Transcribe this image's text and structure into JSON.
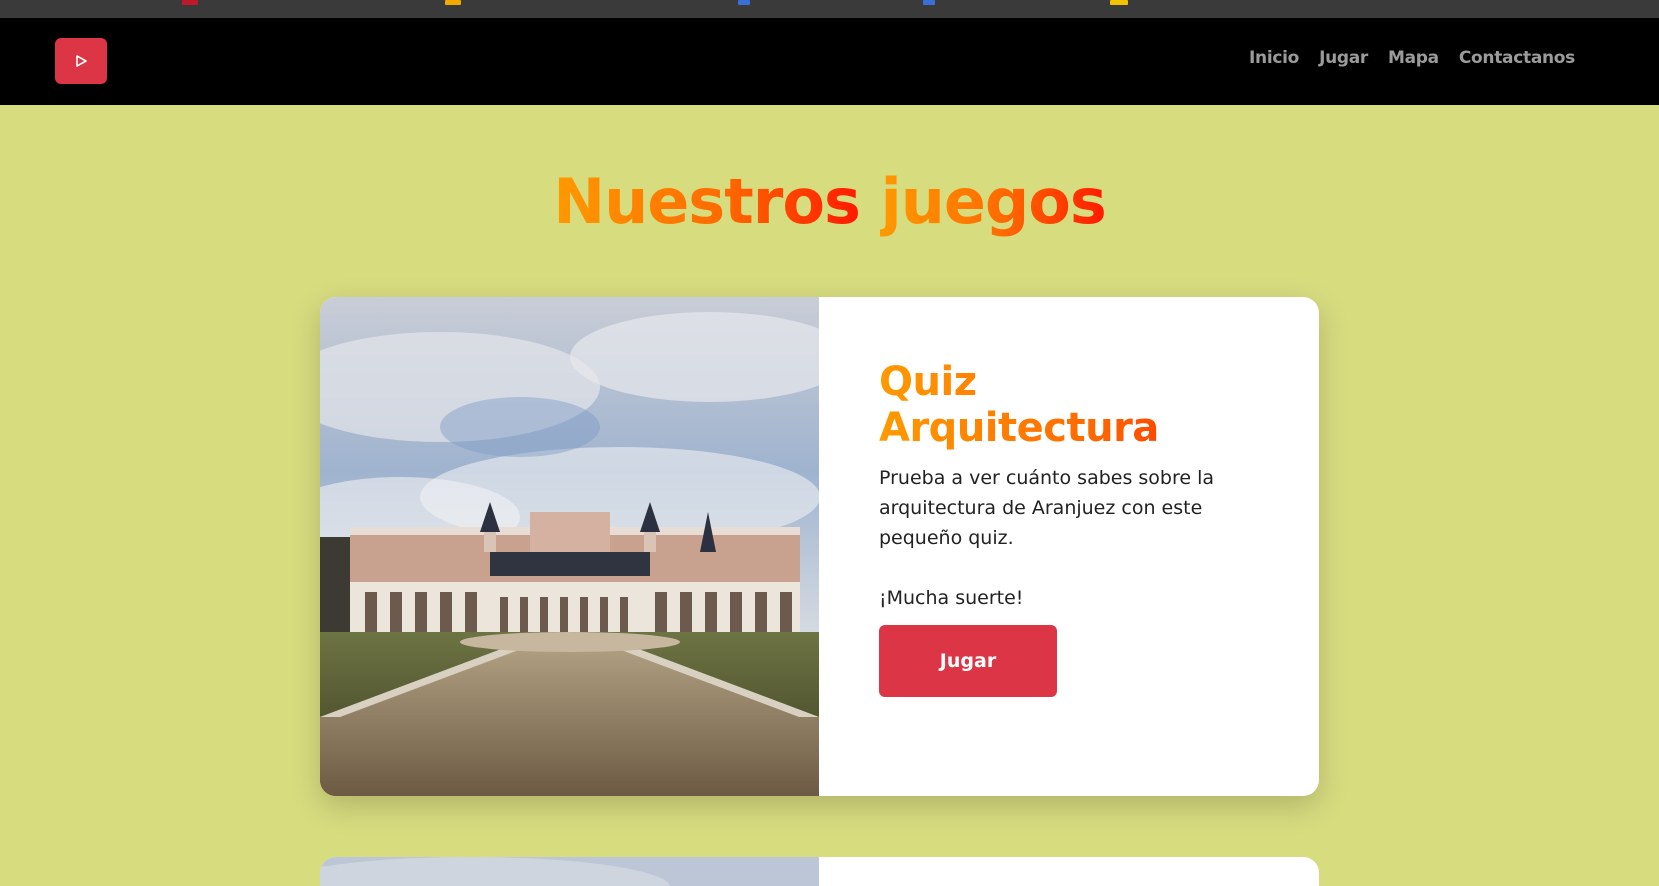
{
  "navbar": {
    "links": [
      "Inicio",
      "Jugar",
      "Mapa",
      "Contactanos"
    ]
  },
  "page": {
    "title_part1": "Nuestros",
    "title_part2": "juegos"
  },
  "cards": [
    {
      "title": "Quiz Arquitectura",
      "description": "Prueba a ver cuánto sabes sobre la arquitectura de Aranjuez con este pequeño quiz.",
      "tagline": "¡Mucha suerte!",
      "button_label": "Jugar",
      "image_icon": "palace-photo"
    }
  ],
  "colors": {
    "background": "#d7dc7f",
    "navbar": "#000000",
    "accent_red": "#dc3545",
    "title_gradient_start": "#ff9a00",
    "title_gradient_end": "#ff1a00"
  }
}
